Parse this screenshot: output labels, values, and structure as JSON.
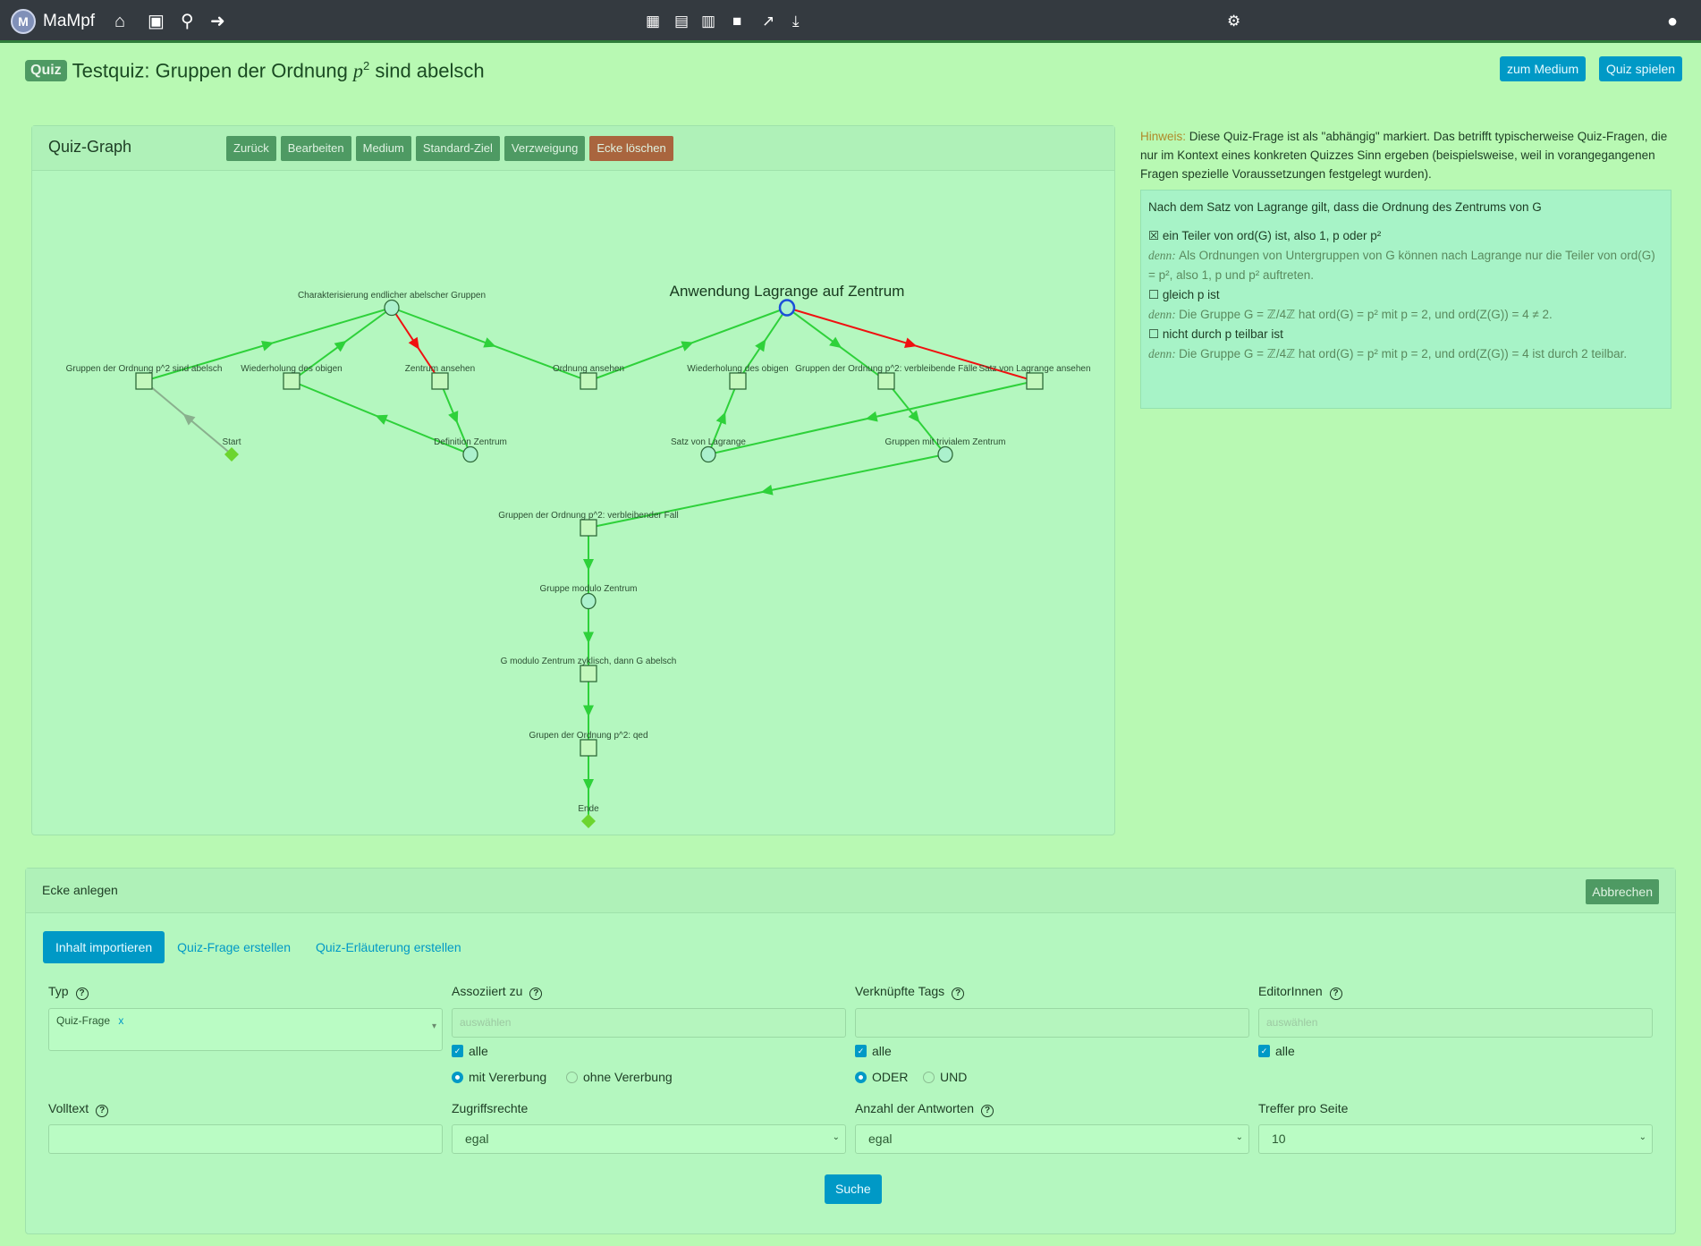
{
  "nav": {
    "brand": "MaMpf",
    "logo": "M",
    "left_icons": [
      "home-icon",
      "lecture-icon",
      "search-icon",
      "logout-icon"
    ],
    "center_icons": [
      "calendar-icon",
      "clipboard-icon",
      "news-icon",
      "comment-icon",
      "chart-icon",
      "download-icon"
    ],
    "right_icons": [
      "users-cog-icon",
      "user-icon"
    ]
  },
  "header": {
    "badge": "Quiz",
    "title": "Testquiz: Gruppen der Ordnung ",
    "title_math": "p",
    "title_sup": "2",
    "title_end": " sind abelsch",
    "to_medium": "zum Medium",
    "play": "Quiz spielen"
  },
  "graph_card": {
    "title": "Quiz-Graph",
    "buttons": [
      "Zurück",
      "Bearbeiten",
      "Medium",
      "Standard-Ziel",
      "Verzweigung",
      "Ecke löschen"
    ],
    "selected_label": "Anwendung Lagrange auf Zentrum",
    "nodes": [
      {
        "id": "start",
        "label": "Start",
        "kind": "diamond"
      },
      {
        "id": "abelsch",
        "label": "Gruppen der Ordnung p^2 sind abelsch",
        "kind": "square"
      },
      {
        "id": "wied1",
        "label": "Wiederholung des obigen",
        "kind": "square"
      },
      {
        "id": "zentrum",
        "label": "Zentrum ansehen",
        "kind": "square"
      },
      {
        "id": "ordnung",
        "label": "Ordnung ansehen",
        "kind": "square"
      },
      {
        "id": "wied2",
        "label": "Wiederholung des obigen",
        "kind": "square"
      },
      {
        "id": "faelle",
        "label": "Gruppen der Ordnung p^2: verbleibende Fälle",
        "kind": "square"
      },
      {
        "id": "lagansehen",
        "label": "Satz von Lagrange ansehen",
        "kind": "square"
      },
      {
        "id": "charakt",
        "label": "Charakterisierung endlicher abelscher Gruppen",
        "kind": "circle"
      },
      {
        "id": "anwend",
        "label": "Anwendung Lagrange auf Zentrum",
        "kind": "circle-selected"
      },
      {
        "id": "defz",
        "label": "Definition Zentrum",
        "kind": "circle"
      },
      {
        "id": "lagrange",
        "label": "Satz von Lagrange",
        "kind": "circle"
      },
      {
        "id": "trivial",
        "label": "Gruppen mit trivialem Zentrum",
        "kind": "circle"
      },
      {
        "id": "fall",
        "label": "Gruppen der Ordnung p^2: verbleibender Fall",
        "kind": "square"
      },
      {
        "id": "modulo",
        "label": "Gruppe modulo Zentrum",
        "kind": "circle"
      },
      {
        "id": "zyklisch",
        "label": "G modulo Zentrum zyklisch, dann G abelsch",
        "kind": "square"
      },
      {
        "id": "qed",
        "label": "Grupen der Ordnung p^2: qed",
        "kind": "square"
      },
      {
        "id": "ende",
        "label": "Ende",
        "kind": "diamond"
      }
    ],
    "edges": [
      {
        "from": "start",
        "to": "abelsch",
        "color": "gray"
      },
      {
        "from": "abelsch",
        "to": "charakt",
        "color": "green"
      },
      {
        "from": "wied1",
        "to": "charakt",
        "color": "green"
      },
      {
        "from": "charakt",
        "to": "zentrum",
        "color": "red"
      },
      {
        "from": "charakt",
        "to": "ordnung",
        "color": "green"
      },
      {
        "from": "zentrum",
        "to": "defz",
        "color": "green"
      },
      {
        "from": "defz",
        "to": "wied1",
        "color": "green"
      },
      {
        "from": "ordnung",
        "to": "anwend",
        "color": "green"
      },
      {
        "from": "wied2",
        "to": "anwend",
        "color": "green"
      },
      {
        "from": "anwend",
        "to": "faelle",
        "color": "green"
      },
      {
        "from": "anwend",
        "to": "lagansehen",
        "color": "red"
      },
      {
        "from": "lagrange",
        "to": "wied2",
        "color": "green"
      },
      {
        "from": "lagansehen",
        "to": "lagrange",
        "color": "green"
      },
      {
        "from": "faelle",
        "to": "trivial",
        "color": "green"
      },
      {
        "from": "trivial",
        "to": "fall",
        "color": "green"
      },
      {
        "from": "fall",
        "to": "modulo",
        "color": "green"
      },
      {
        "from": "modulo",
        "to": "zyklisch",
        "color": "green"
      },
      {
        "from": "zyklisch",
        "to": "qed",
        "color": "green"
      },
      {
        "from": "qed",
        "to": "ende",
        "color": "green"
      }
    ]
  },
  "hint": {
    "label": "Hinweis:",
    "text": " Diese Quiz-Frage ist als \"abhängig\" markiert. Das betrifft typischerweise Quiz-Fragen, die nur im Kontext eines konkreten Quizzes Sinn ergeben (beispielsweise, weil in vorangegangenen Fragen spezielle Voraussetzungen festgelegt wurden)."
  },
  "question": {
    "text": "Nach dem Satz von Lagrange gilt, dass die Ordnung des Zentrums von G",
    "answers": [
      {
        "mark": "☒",
        "text": "ein Teiler von ord(G) ist, also 1, p oder p²",
        "expl": "Als Ordnungen von Untergruppen von G können nach Lagrange nur die Teiler von ord(G) = p², also 1, p und p² auftreten."
      },
      {
        "mark": "☐",
        "text": "gleich p ist",
        "expl": "Die Gruppe G = ℤ/4ℤ hat ord(G) = p² mit p = 2, und ord(Z(G)) = 4 ≠ 2."
      },
      {
        "mark": "☐",
        "text": "nicht durch p teilbar ist",
        "expl": "Die Gruppe G = ℤ/4ℤ hat ord(G) = p² mit p = 2, und ord(Z(G)) = 4 ist durch 2 teilbar."
      }
    ],
    "expl_prefix": "denn:"
  },
  "form": {
    "title": "Ecke anlegen",
    "cancel": "Abbrechen",
    "tabs": [
      "Inhalt importieren",
      "Quiz-Frage erstellen",
      "Quiz-Erläuterung erstellen"
    ],
    "typ_label": "Typ",
    "typ_value": "Quiz-Frage",
    "typ_remove": "x",
    "assoc_label": "Assoziiert zu",
    "assoc_placeholder": "auswählen",
    "assoc_all": "alle",
    "inherit_with": "mit Vererbung",
    "inherit_without": "ohne Vererbung",
    "tags_label": "Verknüpfte Tags",
    "tags_all": "alle",
    "or": "ODER",
    "and": "UND",
    "editors_label": "EditorInnen",
    "editors_placeholder": "auswählen",
    "editors_all": "alle",
    "fulltext_label": "Volltext",
    "access_label": "Zugriffsrechte",
    "access_value": "egal",
    "answers_label": "Anzahl der Antworten",
    "answers_value": "egal",
    "per_page_label": "Treffer pro Seite",
    "per_page_value": "10",
    "search": "Suche"
  }
}
